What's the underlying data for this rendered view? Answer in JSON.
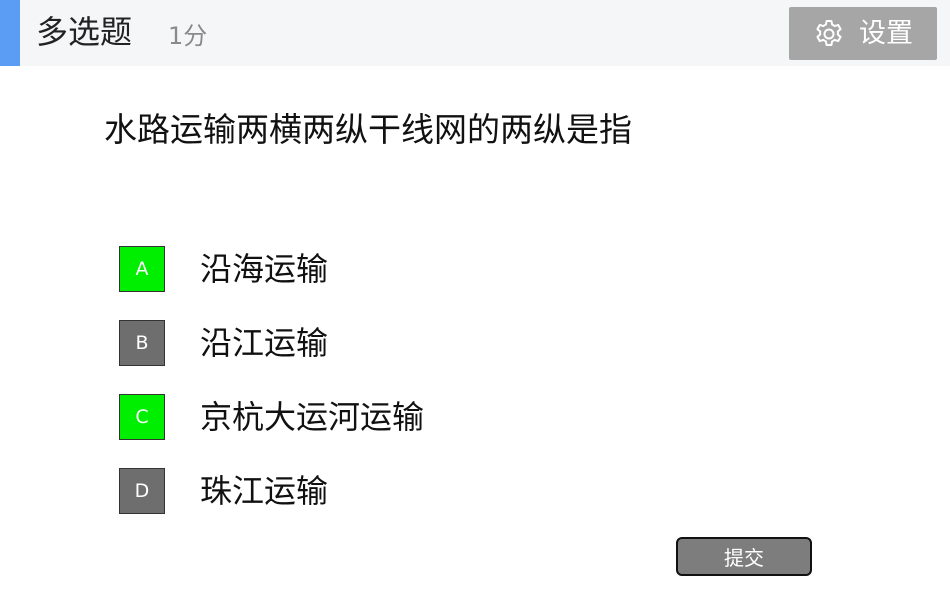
{
  "header": {
    "question_type": "多选题",
    "score": "1分",
    "settings_label": "设置",
    "settings_icon": "gear-icon",
    "accent_color": "#5b9cf5"
  },
  "question": {
    "text": "水路运输两横两纵干线网的两纵是指"
  },
  "options": [
    {
      "letter": "A",
      "text": "沿海运输",
      "selected": true
    },
    {
      "letter": "B",
      "text": "沿江运输",
      "selected": false
    },
    {
      "letter": "C",
      "text": "京杭大运河运输",
      "selected": true
    },
    {
      "letter": "D",
      "text": "珠江运输",
      "selected": false
    }
  ],
  "colors": {
    "selected": "#00ee00",
    "unselected": "#6e6e6e",
    "button": "#7d7d7d"
  },
  "submit": {
    "label": "提交"
  }
}
